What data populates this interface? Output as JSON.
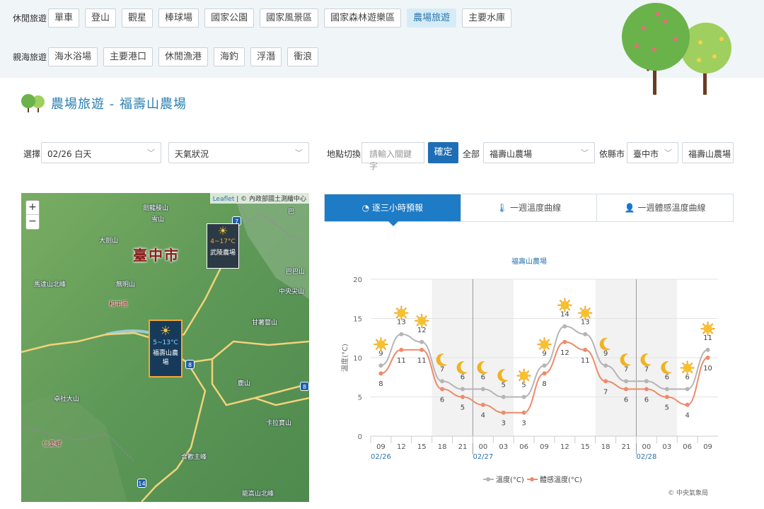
{
  "top_nav": {
    "rows": [
      {
        "label": "休閒旅遊",
        "items": [
          "單車",
          "登山",
          "觀星",
          "棒球場",
          "國家公園",
          "國家風景區",
          "國家森林遊樂區",
          "農場旅遊",
          "主要水庫"
        ],
        "active": 7
      },
      {
        "label": "親海旅遊",
        "items": [
          "海水浴場",
          "主要港口",
          "休閒漁港",
          "海釣",
          "浮潛",
          "衝浪"
        ],
        "active": -1
      }
    ]
  },
  "page_title": "農場旅遊 - 福壽山農場",
  "filters": {
    "select_label": "選擇",
    "date_value": "02/26 白天",
    "weather_value": "天氣狀況",
    "location_label": "地點切換",
    "search_placeholder": "請輸入關鍵字",
    "confirm_label": "確定",
    "all_label": "全部",
    "farm_value": "福壽山農場",
    "county_label": "依縣市",
    "county_value": "臺中市",
    "farm2_value": "福壽山農場"
  },
  "map": {
    "attribution_leaflet": "Leaflet",
    "attribution_source": "| © 內政部國土測繪中心",
    "city_label": "臺中市",
    "zoom_in": "+",
    "zoom_out": "−",
    "place_labels": [
      "劍龍稜山",
      "雪山",
      "大劍山",
      "馬達山北峰",
      "無明山",
      "和平區",
      "甘薯蔔山",
      "卓社大山",
      "鹿山",
      "卡拉寶山",
      "仁愛鄉",
      "合歡主峰",
      "能高山北峰",
      "巴巴山",
      "中央尖山",
      "巴"
    ],
    "road_numbers": [
      "7",
      "8",
      "8",
      "14"
    ],
    "markers": [
      {
        "temp": "4~17°C",
        "name": "武陵農場",
        "weather_icon": "partly-cloudy-icon"
      },
      {
        "temp": "5~13°C",
        "name": "福壽山農場",
        "weather_icon": "partly-cloudy-icon"
      }
    ]
  },
  "tabs": [
    {
      "label": "逐三小時預報",
      "icon": "3h-clock-icon",
      "active": true
    },
    {
      "label": "一週溫度曲線",
      "icon": "thermometer-icon",
      "active": false
    },
    {
      "label": "一週體感溫度曲線",
      "icon": "person-thermometer-icon",
      "active": false
    }
  ],
  "chart_data": {
    "type": "line",
    "title": "福壽山農場",
    "ylabel": "溫度(°C)",
    "ylim": [
      0,
      20
    ],
    "yticks": [
      0,
      5,
      10,
      15,
      20
    ],
    "categories": [
      "09",
      "12",
      "15",
      "18",
      "21",
      "00",
      "03",
      "06",
      "09",
      "12",
      "15",
      "18",
      "21",
      "00",
      "03",
      "06",
      "09"
    ],
    "date_labels": [
      {
        "index": 0,
        "text": "02/26"
      },
      {
        "index": 5,
        "text": "02/27"
      },
      {
        "index": 13,
        "text": "02/28"
      }
    ],
    "night_bands": [
      [
        3,
        7
      ],
      [
        11,
        15
      ]
    ],
    "series": [
      {
        "name": "溫度(°C)",
        "color": "#b5b5b5",
        "values": [
          9,
          13,
          12,
          7,
          6,
          6,
          5,
          5,
          9,
          14,
          13,
          9,
          7,
          7,
          6,
          6,
          11
        ]
      },
      {
        "name": "體感溫度(°C)",
        "color": "#ef8a6a",
        "values": [
          8,
          11,
          11,
          6,
          5,
          4,
          3,
          3,
          8,
          12,
          11,
          7,
          6,
          6,
          5,
          4,
          10
        ]
      }
    ],
    "weather_icons": [
      "sun",
      "sun",
      "sun",
      "moon",
      "moon",
      "moon",
      "moon",
      "sun",
      "sun",
      "sun",
      "sun",
      "moon",
      "moon",
      "moon",
      "moon",
      "sun",
      "sun"
    ],
    "credit": "© 中央氣象局"
  },
  "colors": {
    "accent": "#1e7bc6",
    "title": "#2b7fb0",
    "temp": "#b5b5b5",
    "feel": "#ef8a6a"
  }
}
